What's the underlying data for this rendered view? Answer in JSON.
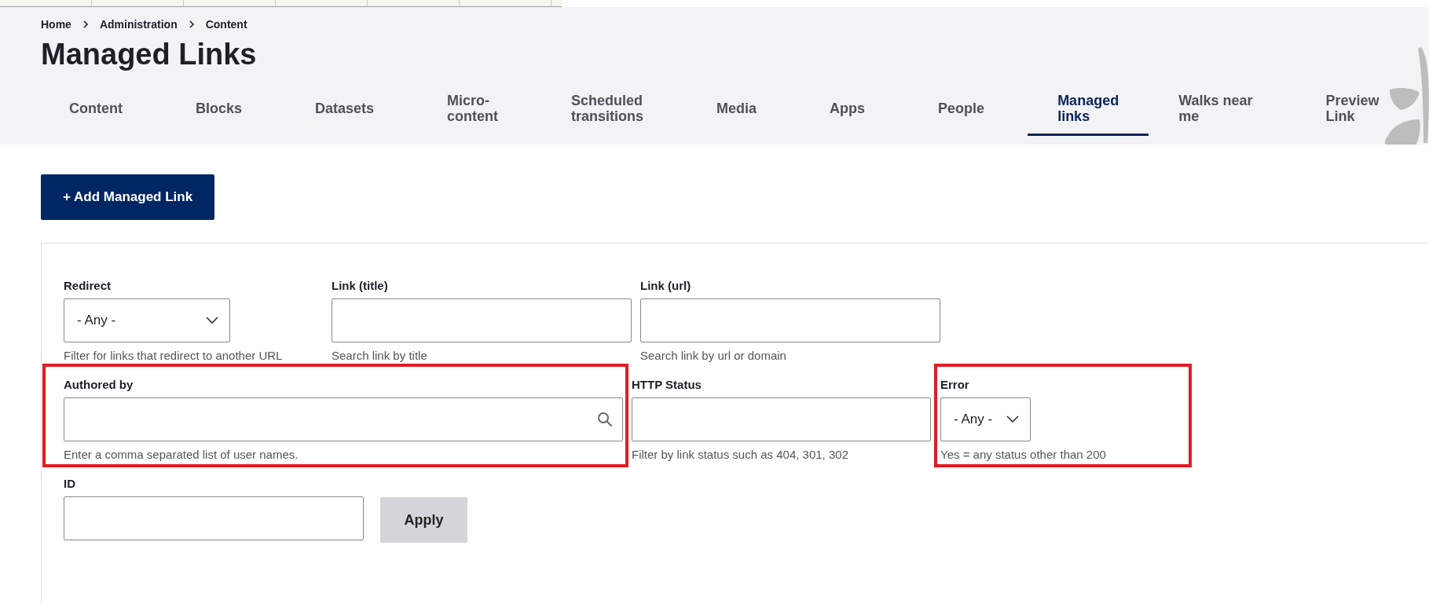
{
  "breadcrumb": [
    "Home",
    "Administration",
    "Content"
  ],
  "title": "Managed Links",
  "tabs": [
    {
      "label": "Content",
      "selected": false
    },
    {
      "label": "Blocks",
      "selected": false
    },
    {
      "label": "Datasets",
      "selected": false
    },
    {
      "label": "Micro-\ncontent",
      "selected": false
    },
    {
      "label": "Scheduled\ntransitions",
      "selected": false
    },
    {
      "label": "Media",
      "selected": false
    },
    {
      "label": "Apps",
      "selected": false
    },
    {
      "label": "People",
      "selected": false
    },
    {
      "label": "Managed\nlinks",
      "selected": true
    },
    {
      "label": "Walks near\nme",
      "selected": false
    },
    {
      "label": "Preview\nLink",
      "selected": false
    }
  ],
  "add_button": "+ Add Managed Link",
  "filters": {
    "fields": [
      {
        "kind": "select",
        "label": "Redirect",
        "value": "- Any -",
        "description": "Filter for links that redirect to another URL",
        "highlighted": false
      },
      {
        "kind": "text",
        "label": "Link (title)",
        "description": "Search link by title",
        "highlighted": false
      },
      {
        "kind": "text",
        "label": "Link (url)",
        "description": "Search link by url or domain",
        "highlighted": false
      },
      {
        "kind": "search",
        "label": "Authored by",
        "description": "Enter a comma separated list of user names.",
        "highlighted": true
      },
      {
        "kind": "text",
        "label": "HTTP Status",
        "description": "Filter by link status such as 404, 301, 302",
        "highlighted": false
      },
      {
        "kind": "select",
        "label": "Error",
        "value": "- Any -",
        "description": "Yes = any status other than 200",
        "highlighted": true
      },
      {
        "kind": "text",
        "label": "ID",
        "highlighted": false
      }
    ],
    "apply_button": "Apply"
  }
}
